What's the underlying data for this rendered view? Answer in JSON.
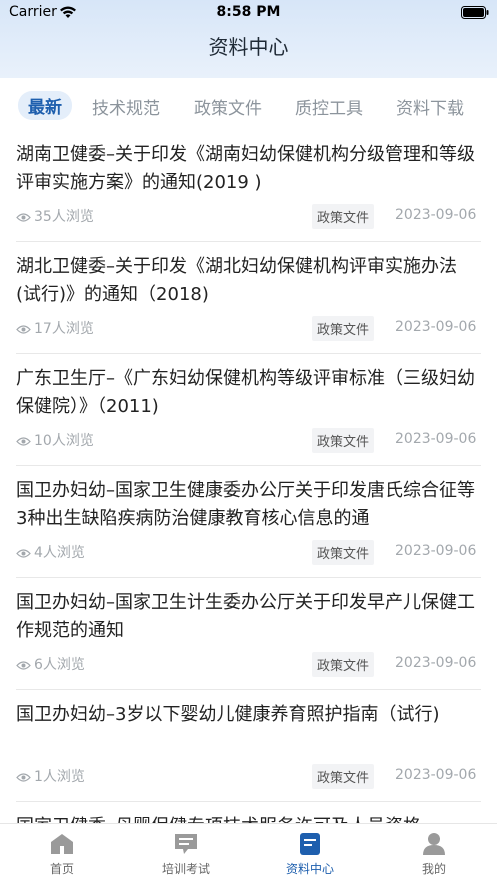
{
  "status_bar": {
    "carrier": "Carrier",
    "time": "8:58 PM"
  },
  "header": {
    "title": "资料中心"
  },
  "tabs": [
    {
      "label": "最新",
      "active": true
    },
    {
      "label": "技术规范"
    },
    {
      "label": "政策文件"
    },
    {
      "label": "质控工具"
    },
    {
      "label": "资料下载"
    }
  ],
  "items": [
    {
      "title": "湖南卫健委–关于印发《湖南妇幼保健机构分级管理和等级评审实施方案》的通知(2019 )",
      "views": "35人浏览",
      "tag": "政策文件",
      "date": "2023-09-06"
    },
    {
      "title": "湖北卫健委–关于印发《湖北妇幼保健机构评审实施办法(试行)》的通知（2018)",
      "views": "17人浏览",
      "tag": "政策文件",
      "date": "2023-09-06"
    },
    {
      "title": "广东卫生厅–《广东妇幼保健机构等级评审标准（三级妇幼保健院）》（2011)",
      "views": "10人浏览",
      "tag": "政策文件",
      "date": "2023-09-06"
    },
    {
      "title": "国卫办妇幼–国家卫生健康委办公厅关于印发唐氏综合征等3种出生缺陷疾病防治健康教育核心信息的通",
      "views": "4人浏览",
      "tag": "政策文件",
      "date": "2023-09-06"
    },
    {
      "title": "国卫办妇幼–国家卫生计生委办公厅关于印发早产儿保健工作规范的通知",
      "views": "6人浏览",
      "tag": "政策文件",
      "date": "2023-09-06"
    },
    {
      "title": "国卫办妇幼–3岁以下婴幼儿健康养育照护指南（试行)",
      "views": "1人浏览",
      "tag": "政策文件",
      "date": "2023-09-06"
    },
    {
      "title": "国家卫健委–母婴保健专项技术服务许可及人员资格",
      "views": "",
      "tag": "",
      "date": ""
    }
  ],
  "tabbar": [
    {
      "label": "首页",
      "icon": "home-icon"
    },
    {
      "label": "培训考试",
      "icon": "chat-icon"
    },
    {
      "label": "资料中心",
      "icon": "document-icon",
      "active": true
    },
    {
      "label": "我的",
      "icon": "user-icon"
    }
  ],
  "colors": {
    "accent": "#1e5fae",
    "header_bg": "#d7e6f8"
  }
}
